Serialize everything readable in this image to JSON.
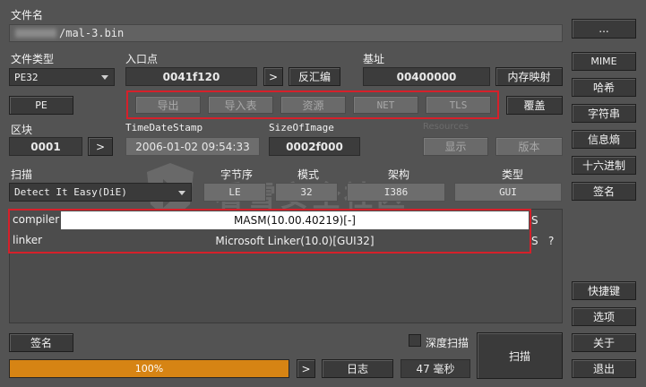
{
  "file": {
    "label": "文件名",
    "path": "/mal-3.bin",
    "browse_label": "..."
  },
  "file_type": {
    "label": "文件类型",
    "value": "PE32"
  },
  "entry_point": {
    "label": "入口点",
    "value": "0041f120",
    "next_label": ">",
    "disasm_label": "反汇编"
  },
  "base": {
    "label": "基址",
    "value": "00400000",
    "memmap_label": "内存映射"
  },
  "pe_button": "PE",
  "tabs": [
    {
      "label": "导出"
    },
    {
      "label": "导入表"
    },
    {
      "label": "资源"
    },
    {
      "label": "NET"
    },
    {
      "label": "TLS"
    }
  ],
  "overlay_label": "覆盖",
  "section": {
    "label": "区块",
    "value": "0001",
    "next_label": ">"
  },
  "timestamp": {
    "label": "TimeDateStamp",
    "value": "2006-01-02 09:54:33"
  },
  "size_of_image": {
    "label": "SizeOfImage",
    "value": "0002f000"
  },
  "resources": {
    "label": "Resources",
    "show_label": "显示",
    "version_label": "版本"
  },
  "scan": {
    "label": "扫描",
    "engine": "Detect It Easy(DiE)",
    "endianness_label": "字节序",
    "endianness": "LE",
    "mode_label": "模式",
    "mode": "32",
    "arch_label": "架构",
    "arch": "I386",
    "type_label": "类型",
    "type": "GUI"
  },
  "results": [
    {
      "kind": "compiler",
      "value": "MASM(10.00.40219)[-]",
      "flag": "S",
      "extra": ""
    },
    {
      "kind": "linker",
      "value": "Microsoft Linker(10.0)[GUI32]",
      "flag": "S",
      "extra": "?"
    }
  ],
  "right_panel": [
    "MIME",
    "哈希",
    "字符串",
    "信息熵",
    "十六进制",
    "签名"
  ],
  "bottom_right": [
    "快捷键",
    "选项",
    "关于",
    "退出"
  ],
  "signature_label": "签名",
  "deep_scan_label": "深度扫描",
  "scan_button": "扫描",
  "progress": {
    "percent": 1.0,
    "text": "100%"
  },
  "log_label": "日志",
  "elapsed": "47 毫秒",
  "progress_next": ">",
  "watermark_text": "看雪安全社区",
  "colors": {
    "accent": "#d68414",
    "highlight": "#d6202a"
  }
}
